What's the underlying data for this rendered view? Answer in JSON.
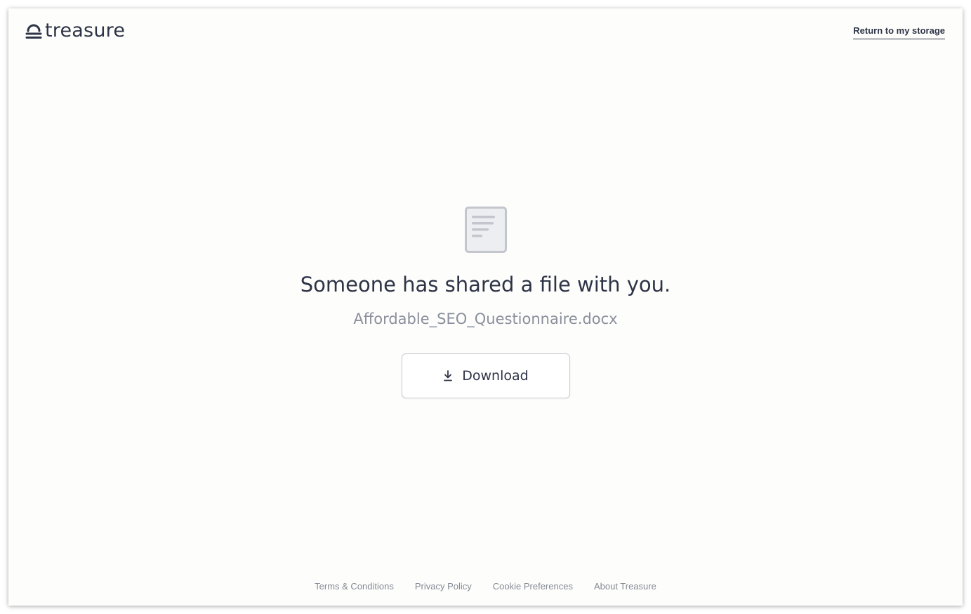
{
  "header": {
    "logo_text": "treasure",
    "logo_icon": "lock-icon",
    "return_link": "Return to my storage"
  },
  "main": {
    "file_icon": "document-icon",
    "title": "Someone has shared a file with you.",
    "filename": "Affordable_SEO_Questionnaire.docx",
    "download": {
      "icon": "download-icon",
      "label": "Download"
    }
  },
  "footer": {
    "links": [
      {
        "label": "Terms & Conditions"
      },
      {
        "label": "Privacy Policy"
      },
      {
        "label": "Cookie Preferences"
      },
      {
        "label": "About Treasure"
      }
    ]
  },
  "colors": {
    "text_dark": "#2e3447",
    "text_muted": "#8a8f9c",
    "background": "#fdfdfb",
    "border": "#c9ccd3",
    "icon_gray": "#c3c6cd"
  }
}
